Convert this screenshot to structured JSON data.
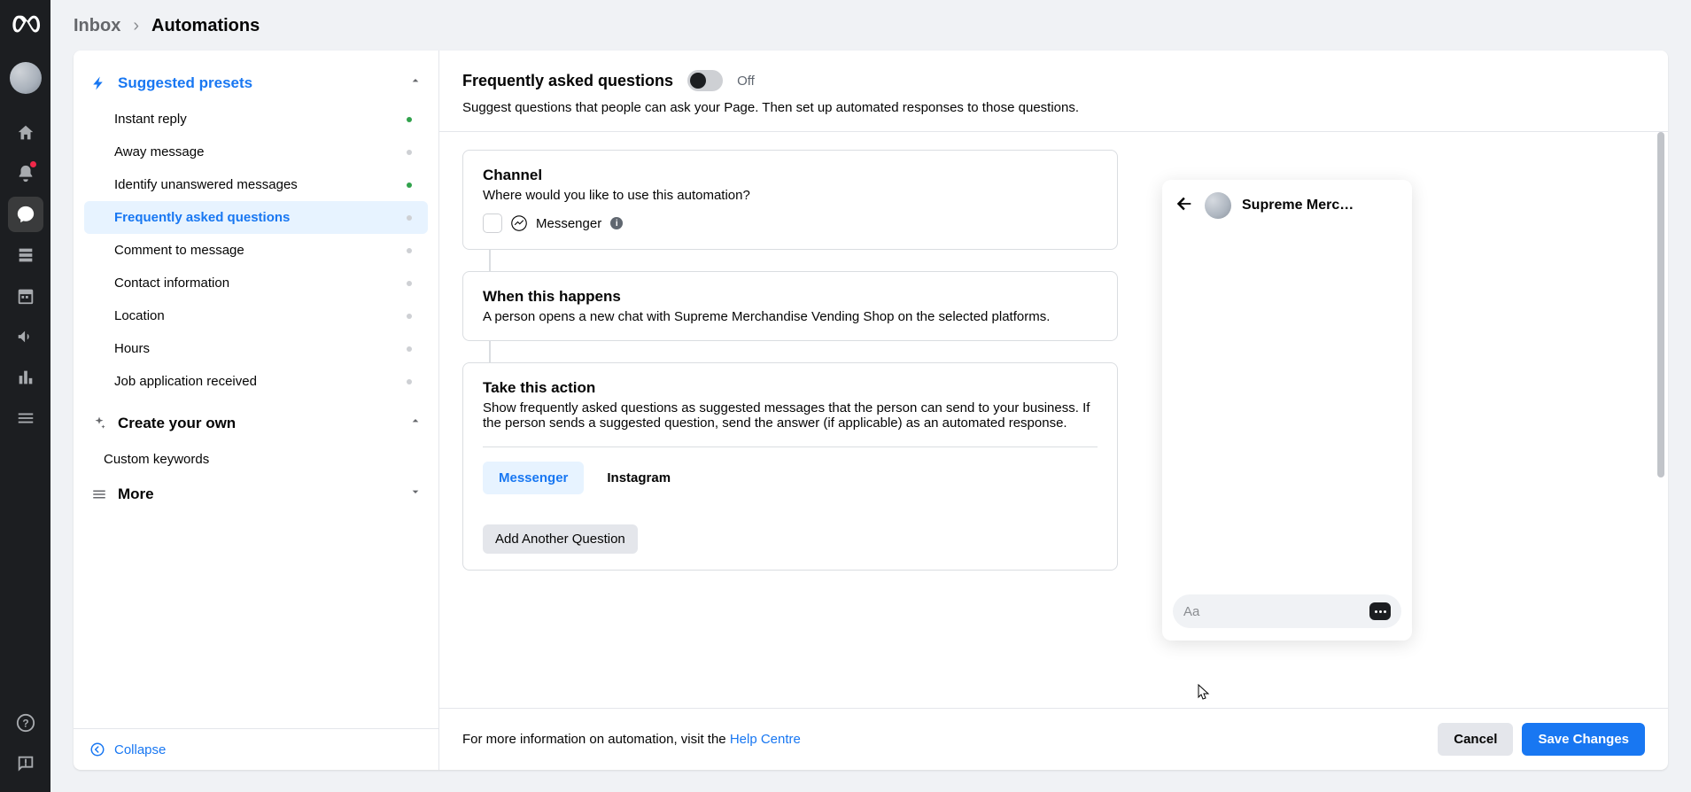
{
  "breadcrumb": {
    "root": "Inbox",
    "current": "Automations"
  },
  "sidebar": {
    "suggested_title": "Suggested presets",
    "presets": [
      {
        "label": "Instant reply",
        "active": true
      },
      {
        "label": "Away message",
        "active": false
      },
      {
        "label": "Identify unanswered messages",
        "active": true
      },
      {
        "label": "Frequently asked questions",
        "active": false
      },
      {
        "label": "Comment to message",
        "active": false
      },
      {
        "label": "Contact information",
        "active": false
      },
      {
        "label": "Location",
        "active": false
      },
      {
        "label": "Hours",
        "active": false
      },
      {
        "label": "Job application received",
        "active": false
      }
    ],
    "create_title": "Create your own",
    "create_item": "Custom keywords",
    "more_title": "More",
    "collapse": "Collapse"
  },
  "main": {
    "title": "Frequently asked questions",
    "toggle_label": "Off",
    "subtitle": "Suggest questions that people can ask your Page. Then set up automated responses to those questions.",
    "channel": {
      "title": "Channel",
      "subtitle": "Where would you like to use this automation?",
      "option": "Messenger"
    },
    "when": {
      "title": "When this happens",
      "subtitle": "A person opens a new chat with Supreme Merchandise Vending Shop on the selected platforms."
    },
    "action": {
      "title": "Take this action",
      "subtitle": "Show frequently asked questions as suggested messages that the person can send to your business. If the person sends a suggested question, send the answer (if applicable) as an automated response.",
      "tab_messenger": "Messenger",
      "tab_instagram": "Instagram",
      "add_question": "Add Another Question"
    }
  },
  "preview": {
    "name": "Supreme Merc…",
    "placeholder": "Aa"
  },
  "footer": {
    "text": "For more information on automation, visit the ",
    "link": "Help Centre",
    "cancel": "Cancel",
    "save": "Save Changes"
  },
  "colors": {
    "accent": "#1877f2",
    "success": "#31a24c"
  }
}
